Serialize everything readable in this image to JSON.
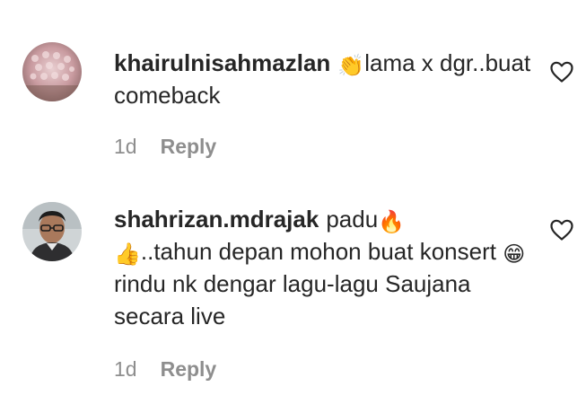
{
  "comments": [
    {
      "username": "khairulnisahmazlan",
      "parts": {
        "e1": "👏",
        "t1": "lama x dgr..buat comeback"
      },
      "age": "1d",
      "reply_label": "Reply"
    },
    {
      "username": "shahrizan.mdrajak",
      "parts": {
        "t1": "padu",
        "e1": "🔥",
        "e2": "👍",
        "t2": "..tahun depan mohon buat konsert ",
        "e3": "😁",
        "t3": " rindu nk dengar lagu-lagu Saujana secara live"
      },
      "age": "1d",
      "reply_label": "Reply"
    }
  ],
  "icons": {
    "like": "heart-outline-icon",
    "emoji_1": "clapping-hands-icon",
    "emoji_2": "fire-icon",
    "emoji_3": "thumbs-up-icon",
    "emoji_4": "grinning-face-icon"
  },
  "colors": {
    "text": "#262626",
    "secondary": "#8e8e8e"
  }
}
